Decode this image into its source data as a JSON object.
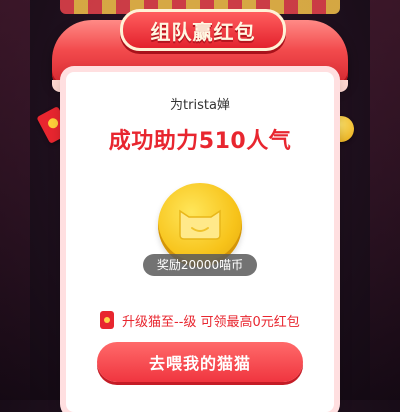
{
  "header": {
    "title": "组队赢红包"
  },
  "card": {
    "helper_line": "为trista婵",
    "headline": "成功助力510人气",
    "reward_pill": "奖励20000喵币",
    "upgrade_text": "升级猫至--级 可领最高0元红包",
    "cta_label": "去喂我的猫猫"
  },
  "colors": {
    "accent_red": "#e8262f",
    "coin_gold": "#f7c31a",
    "background": "#1d0f1c"
  },
  "icons": {
    "coin": "tmall-cat-coin-icon",
    "envelope": "red-envelope-icon"
  }
}
